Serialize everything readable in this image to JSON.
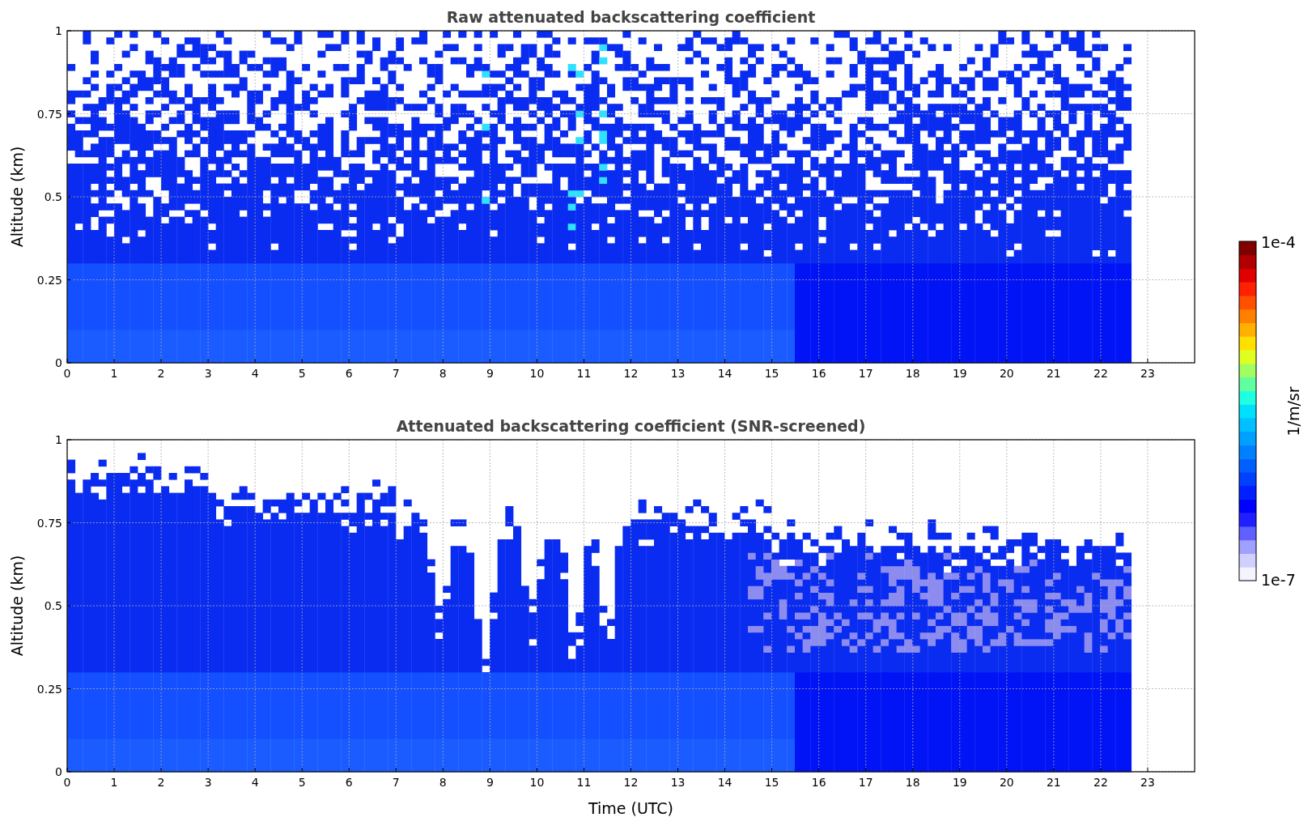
{
  "panels": [
    {
      "kind": "raw",
      "title": "Raw attenuated backscattering coefficient",
      "ylabel": "Altitude (km)",
      "yticks": [
        "1",
        "0.75",
        "0.5",
        "0.25",
        "0"
      ],
      "xticks": [
        "0",
        "1",
        "2",
        "3",
        "4",
        "5",
        "6",
        "7",
        "8",
        "9",
        "10",
        "11",
        "12",
        "13",
        "14",
        "15",
        "16",
        "17",
        "18",
        "19",
        "20",
        "21",
        "22",
        "23"
      ]
    },
    {
      "kind": "screened",
      "title": "Attenuated backscattering coefficient (SNR-screened)",
      "ylabel": "Altitude (km)",
      "yticks": [
        "1",
        "0.75",
        "0.5",
        "0.25",
        "0"
      ],
      "xticks": [
        "0",
        "1",
        "2",
        "3",
        "4",
        "5",
        "6",
        "7",
        "8",
        "9",
        "10",
        "11",
        "12",
        "13",
        "14",
        "15",
        "16",
        "17",
        "18",
        "19",
        "20",
        "21",
        "22",
        "23"
      ]
    }
  ],
  "xlabel": "Time (UTC)",
  "colorbar": {
    "max_label": "1e-4",
    "min_label": "1e-7",
    "unit": "1/m/sr"
  }
}
